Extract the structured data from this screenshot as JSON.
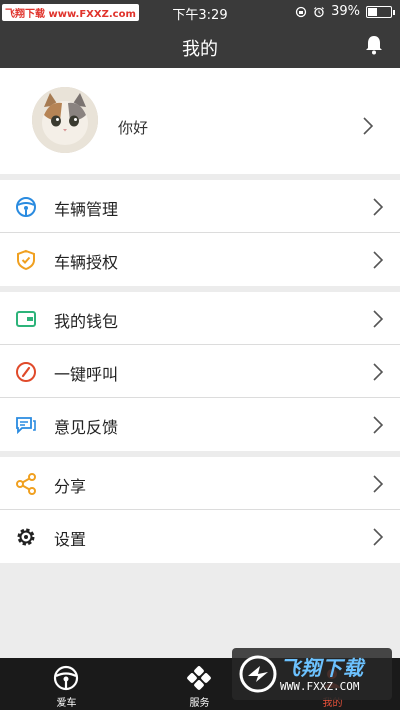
{
  "status_bar": {
    "watermark": "飞翔下载 www.FXXZ.com",
    "time": "下午3:29",
    "battery": "39%",
    "battery_level": 0.39
  },
  "nav": {
    "title": "我的"
  },
  "profile": {
    "name": "你好"
  },
  "menu": {
    "group1": [
      {
        "label": "车辆管理",
        "icon": "steering-wheel-icon",
        "color": "#2a8be0"
      },
      {
        "label": "车辆授权",
        "icon": "shield-check-icon",
        "color": "#f0a020"
      }
    ],
    "group2": [
      {
        "label": "我的钱包",
        "icon": "wallet-icon",
        "color": "#2db37a"
      },
      {
        "label": "一键呼叫",
        "icon": "phone-icon",
        "color": "#e04a2a"
      },
      {
        "label": "意见反馈",
        "icon": "feedback-icon",
        "color": "#2a8be0"
      }
    ],
    "group3": [
      {
        "label": "分享",
        "icon": "share-icon",
        "color": "#f0a020"
      },
      {
        "label": "设置",
        "icon": "gear-icon",
        "color": "#222222"
      }
    ]
  },
  "tabs": [
    {
      "label": "爱车",
      "icon": "steering-wheel-icon"
    },
    {
      "label": "服务",
      "icon": "clover-icon"
    },
    {
      "label": "我的",
      "icon": "user-icon",
      "active": true
    }
  ],
  "watermark_logo": {
    "title": "飞翔下载",
    "url": "WWW.FXXZ.COM"
  }
}
